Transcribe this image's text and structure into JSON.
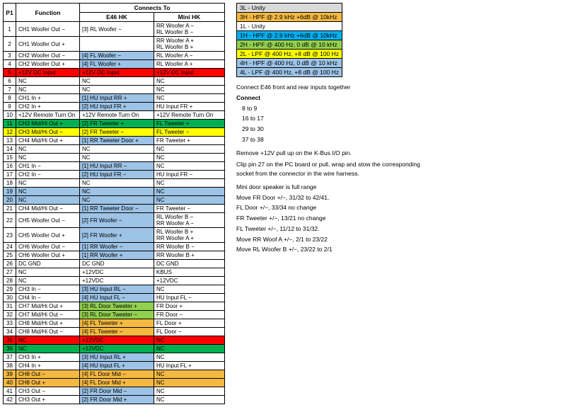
{
  "header": {
    "connects_to": "Connects To",
    "p1": "P1",
    "function": "Function",
    "e46hk": "E46 HK",
    "minihk": "Mini HK"
  },
  "rows": [
    {
      "p1": "1",
      "func": "CH1 Woofer Out −",
      "e46": "[3] RL Woofer −",
      "mini": "RR Woofer A −",
      "mini2": "RL Woofer B −",
      "rcolor": "",
      "e46color": "",
      "minicolor": ""
    },
    {
      "p1": "2",
      "func": "CH1 Woofer Out +",
      "e46": "",
      "mini": "RR Woofer A +",
      "mini2": "RL Woofer B +",
      "rcolor": "",
      "e46color": "",
      "minicolor": ""
    },
    {
      "p1": "3",
      "func": "CH2 Woofer Out −",
      "e46": "[4] FL Woofer −",
      "mini": "RL Woofer A −",
      "mini2": "",
      "rcolor": "",
      "e46color": "e46-highlight",
      "minicolor": ""
    },
    {
      "p1": "4",
      "func": "CH2 Woofer Out +",
      "e46": "[4] FL Woofer +",
      "mini": "RL Woofer A +",
      "mini2": "",
      "rcolor": "",
      "e46color": "e46-highlight",
      "minicolor": ""
    },
    {
      "p1": "5",
      "func": "+12V DC Input",
      "e46": "+12V DC Input",
      "mini": "+12V DC Input",
      "mini2": "",
      "rcolor": "row-5",
      "e46color": "",
      "minicolor": ""
    },
    {
      "p1": "6",
      "func": "NC",
      "e46": "NC",
      "mini": "NC",
      "mini2": "",
      "rcolor": "",
      "e46color": "",
      "minicolor": ""
    },
    {
      "p1": "7",
      "func": "NC",
      "e46": "NC",
      "mini": "NC",
      "mini2": "",
      "rcolor": "",
      "e46color": "",
      "minicolor": ""
    },
    {
      "p1": "8",
      "func": "CH1 In +",
      "e46": "[1] HU Input RR +",
      "mini": "NC",
      "mini2": "",
      "rcolor": "",
      "e46color": "e46-highlight",
      "minicolor": ""
    },
    {
      "p1": "9",
      "func": "CH2 In +",
      "e46": "[2] HU Input FR +",
      "mini": "HU Input FR +",
      "mini2": "",
      "rcolor": "",
      "e46color": "e46-highlight",
      "minicolor": ""
    },
    {
      "p1": "10",
      "func": "+12V Remote Turn On",
      "e46": "+12V Remote Turn On",
      "mini": "+12V Remote Turn On",
      "mini2": "",
      "rcolor": "",
      "e46color": "",
      "minicolor": ""
    },
    {
      "p1": "11",
      "func": "CH3 Mid/Hi Out +",
      "e46": "[2] FR Tweeter +",
      "mini": "FL Tweeter +",
      "mini2": "",
      "rcolor": "row-11",
      "e46color": "e46-green",
      "minicolor": ""
    },
    {
      "p1": "12",
      "func": "CH3 Mid/Hi Out −",
      "e46": "[2] FR Tweeter −",
      "mini": "FL Tweeter −",
      "mini2": "",
      "rcolor": "row-12",
      "e46color": "e46-yellow",
      "minicolor": ""
    },
    {
      "p1": "13",
      "func": "CH4 Mid/Hi Out +",
      "e46": "[1] RR Tweeter Door +",
      "mini": "FR Tweeter +",
      "mini2": "",
      "rcolor": "",
      "e46color": "e46-highlight",
      "minicolor": ""
    },
    {
      "p1": "14",
      "func": "NC",
      "e46": "NC",
      "mini": "NC",
      "mini2": "",
      "rcolor": "",
      "e46color": "",
      "minicolor": ""
    },
    {
      "p1": "15",
      "func": "NC",
      "e46": "NC",
      "mini": "NC",
      "mini2": "",
      "rcolor": "",
      "e46color": "",
      "minicolor": ""
    },
    {
      "p1": "16",
      "func": "CH1 In −",
      "e46": "[1] HU Input RR −",
      "mini": "NC",
      "mini2": "",
      "rcolor": "",
      "e46color": "e46-highlight",
      "minicolor": ""
    },
    {
      "p1": "17",
      "func": "CH2 In −",
      "e46": "[2] HU Input FR −",
      "mini": "HU Input FR −",
      "mini2": "",
      "rcolor": "",
      "e46color": "e46-highlight",
      "minicolor": ""
    },
    {
      "p1": "18",
      "func": "NC",
      "e46": "NC",
      "mini": "NC",
      "mini2": "",
      "rcolor": "",
      "e46color": "",
      "minicolor": ""
    },
    {
      "p1": "19",
      "func": "NC",
      "e46": "NC",
      "mini": "NC",
      "mini2": "",
      "rcolor": "row-19",
      "e46color": "",
      "minicolor": ""
    },
    {
      "p1": "20",
      "func": "NC",
      "e46": "NC",
      "mini": "NC",
      "mini2": "",
      "rcolor": "row-20",
      "e46color": "",
      "minicolor": ""
    },
    {
      "p1": "21",
      "func": "CH4 Mid/Hi Out −",
      "e46": "[1] RR Tweeter Door −",
      "mini": "FR Tweeter −",
      "mini2": "",
      "rcolor": "",
      "e46color": "e46-highlight",
      "minicolor": ""
    },
    {
      "p1": "22",
      "func": "CH5 Woofer Out −",
      "e46": "[2] FR Woofer −",
      "mini": "RL Woofer B −",
      "mini2": "RR Woofer A −",
      "rcolor": "",
      "e46color": "e46-highlight",
      "minicolor": ""
    },
    {
      "p1": "23",
      "func": "CH5 Woofer Out +",
      "e46": "[2] FR Woofer +",
      "mini": "RL Woofer B +",
      "mini2": "RR Woofer A +",
      "rcolor": "",
      "e46color": "e46-highlight",
      "minicolor": ""
    },
    {
      "p1": "24",
      "func": "CH6 Woofer Out −",
      "e46": "[1] RR Woofer −",
      "mini": "RR Woofer B −",
      "mini2": "",
      "rcolor": "",
      "e46color": "e46-highlight",
      "minicolor": ""
    },
    {
      "p1": "25",
      "func": "CH6 Woofer Out +",
      "e46": "[1] RR Woofer +",
      "mini": "RR Woofer B +",
      "mini2": "",
      "rcolor": "",
      "e46color": "e46-highlight",
      "minicolor": ""
    },
    {
      "p1": "26",
      "func": "DC GND",
      "e46": "DC GND",
      "mini": "DC GND",
      "mini2": "",
      "rcolor": "",
      "e46color": "",
      "minicolor": ""
    },
    {
      "p1": "27",
      "func": "NC",
      "e46": "+12VDC",
      "mini": "KBUS",
      "mini2": "",
      "rcolor": "",
      "e46color": "",
      "minicolor": ""
    },
    {
      "p1": "28",
      "func": "NC",
      "e46": "+12VDC",
      "mini": "+12VDC",
      "mini2": "",
      "rcolor": "",
      "e46color": "",
      "minicolor": ""
    },
    {
      "p1": "29",
      "func": "CH3 In −",
      "e46": "[3] HU Input RL −",
      "mini": "NC",
      "mini2": "",
      "rcolor": "",
      "e46color": "e46-highlight",
      "minicolor": ""
    },
    {
      "p1": "30",
      "func": "CH4 In −",
      "e46": "[4] HU Input FL −",
      "mini": "HU Input FL −",
      "mini2": "",
      "rcolor": "",
      "e46color": "e46-highlight",
      "minicolor": ""
    },
    {
      "p1": "31",
      "func": "CH7 Mid/Hi Out +",
      "e46": "[3] RL Door Tweeter +",
      "mini": "FR Door +",
      "mini2": "",
      "rcolor": "",
      "e46color": "e46-lime",
      "minicolor": ""
    },
    {
      "p1": "32",
      "func": "CH7 Mid/Hi Out −",
      "e46": "[3] RL Door Tweeter −",
      "mini": "FR Door −",
      "mini2": "",
      "rcolor": "",
      "e46color": "e46-lime",
      "minicolor": ""
    },
    {
      "p1": "33",
      "func": "CH8 Mid/Hi Out +",
      "e46": "[4] FL Tweeter +",
      "mini": "FL Door +",
      "mini2": "",
      "rcolor": "",
      "e46color": "e46-orange",
      "minicolor": ""
    },
    {
      "p1": "34",
      "func": "CH8 Mid/Hi Out −",
      "e46": "[4] FL Tweeter −",
      "mini": "FL Door −",
      "mini2": "",
      "rcolor": "",
      "e46color": "e46-orange",
      "minicolor": ""
    },
    {
      "p1": "35",
      "func": "NC",
      "e46": "+12VDC",
      "mini": "NC",
      "mini2": "",
      "rcolor": "row-35",
      "e46color": "",
      "minicolor": ""
    },
    {
      "p1": "36",
      "func": "NC",
      "e46": "+12VDC",
      "mini": "NC",
      "mini2": "",
      "rcolor": "row-36",
      "e46color": "",
      "minicolor": ""
    },
    {
      "p1": "37",
      "func": "CH3 In +",
      "e46": "[3] HU Input RL +",
      "mini": "NC",
      "mini2": "",
      "rcolor": "",
      "e46color": "e46-highlight",
      "minicolor": ""
    },
    {
      "p1": "38",
      "func": "CH4 In +",
      "e46": "[4] HU Input FL +",
      "mini": "HU Input FL +",
      "mini2": "",
      "rcolor": "",
      "e46color": "e46-highlight",
      "minicolor": ""
    },
    {
      "p1": "39",
      "func": "CH8 Out −",
      "e46": "[4] FL Door Mid −",
      "mini": "NC",
      "mini2": "",
      "rcolor": "row-39",
      "e46color": "e46-orange",
      "minicolor": ""
    },
    {
      "p1": "40",
      "func": "CH8 Out +",
      "e46": "[4] FL Door Mid +",
      "mini": "NC",
      "mini2": "",
      "rcolor": "row-40",
      "e46color": "e46-orange",
      "minicolor": ""
    },
    {
      "p1": "41",
      "func": "CH3 Out −",
      "e46": "[2] FR Door Mid −",
      "mini": "NC",
      "mini2": "",
      "rcolor": "",
      "e46color": "e46-highlight",
      "minicolor": ""
    },
    {
      "p1": "42",
      "func": "CH3 Out +",
      "e46": "[2] FR Door Mid +",
      "mini": "NC",
      "mini2": "",
      "rcolor": "",
      "e46color": "e46-highlight",
      "minicolor": ""
    }
  ],
  "legend": [
    {
      "color": "leg-gray",
      "text": "3L - Unity"
    },
    {
      "color": "leg-orange",
      "text": "3H - HPF @ 2.9 kHz +6dB @ 10kHz"
    },
    {
      "color": "leg-white",
      "text": "1L - Unity"
    },
    {
      "color": "leg-teal",
      "text": "1H - HPF @ 2.9 kHz +6dB @ 10kHz"
    },
    {
      "color": "leg-green",
      "text": "2H - HPF @ 400 Hz, 0 dB @ 10 kHz"
    },
    {
      "color": "leg-yellow",
      "text": "2L - LPF @ 400 Hz, +8 dB @ 100 Hz"
    },
    {
      "color": "leg-blue",
      "text": "4H - HPF @ 400 Hz, 0 dB @ 10 kHz"
    },
    {
      "color": "leg-blue",
      "text": "4L - LPF @ 400 Hz, +8 dB @ 100 Hz"
    }
  ],
  "notes": {
    "title": "",
    "connect_title": "Connect E46 front and rear inputs together",
    "connect_label": "Connect",
    "connect_pairs": [
      "8 to 9",
      "16 to 17",
      "29 to 30",
      "37 to 38"
    ],
    "remove_note": "Remove +12V pull up on the K-Bus I/O pin.",
    "clip_note": "Clip pin 27 on the PC board or pull, wrap and stow the corresponding socket from the connector in the wire harness.",
    "door_note": "Mini door speaker is full range",
    "move_notes": [
      "Move FR Door +/−,  31/32 to 42/41.",
      "FL Door +/−,  33/34 no change",
      "FR Tweeter +/−,  13/21 no change",
      "FL Tweeter +/−,  11/12 to 31/32.",
      "Move RR Woof A +/−,  2/1 to 23/22",
      "Move RL Woofer B +/−,  23/22 to 2/1"
    ]
  }
}
